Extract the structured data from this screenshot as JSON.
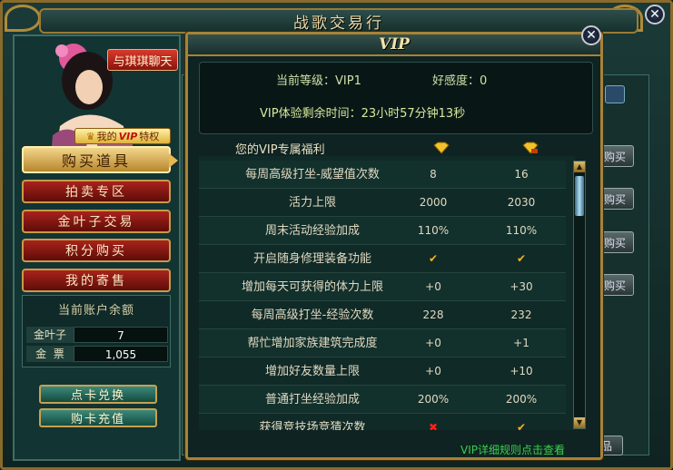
{
  "window": {
    "title": "战歌交易行",
    "close_label": "✕"
  },
  "left_panel": {
    "chat_button": "与琪琪聊天",
    "vip_privilege_prefix": "我的",
    "vip_privilege_vip": "VIP",
    "vip_privilege_suffix": "特权",
    "menu": [
      {
        "label": "购买道具",
        "active": true
      },
      {
        "label": "拍卖专区",
        "active": false
      },
      {
        "label": "金叶子交易",
        "active": false
      },
      {
        "label": "积分购买",
        "active": false
      },
      {
        "label": "我的寄售",
        "active": false
      }
    ],
    "balance": {
      "title": "当前账户余额",
      "rows": [
        {
          "label": "金叶子",
          "value": "7"
        },
        {
          "label": "金  票",
          "value": "1,055"
        }
      ]
    },
    "card_exchange_button": "点卡兑换",
    "card_recharge_button": "购卡充值"
  },
  "background": {
    "buy_labels": [
      "购买",
      "购买",
      "购买",
      "购买"
    ],
    "bottom_button": "品"
  },
  "vip_dialog": {
    "title": "VIP",
    "close_label": "✕",
    "current_level_label": "当前等级：VIP1",
    "favor_label": "好感度：0",
    "remaining_label": "VIP体验剩余时间：23小时57分钟13秒",
    "benefits_header": "您的VIP专属福利",
    "tier_icon_color_1": "#f2c22a",
    "tier_icon_color_2": "#f2c22a",
    "rows": [
      {
        "name": "每周高级打坐-威望值次数",
        "v1": "8",
        "v2": "16"
      },
      {
        "name": "活力上限",
        "v1": "2000",
        "v2": "2030"
      },
      {
        "name": "周末活动经验加成",
        "v1": "110%",
        "v2": "110%"
      },
      {
        "name": "开启随身修理装备功能",
        "v1": "check",
        "v2": "check"
      },
      {
        "name": "增加每天可获得的体力上限",
        "v1": "+0",
        "v2": "+30"
      },
      {
        "name": "每周高级打坐-经验次数",
        "v1": "228",
        "v2": "232"
      },
      {
        "name": "帮忙增加家族建筑完成度",
        "v1": "+0",
        "v2": "+1"
      },
      {
        "name": "增加好友数量上限",
        "v1": "+0",
        "v2": "+10"
      },
      {
        "name": "普通打坐经验加成",
        "v1": "200%",
        "v2": "200%"
      },
      {
        "name": "获得竞技场竞猜次数",
        "v1": "cross",
        "v2": "check"
      }
    ],
    "rules_link": "VIP详细规则点击查看"
  }
}
